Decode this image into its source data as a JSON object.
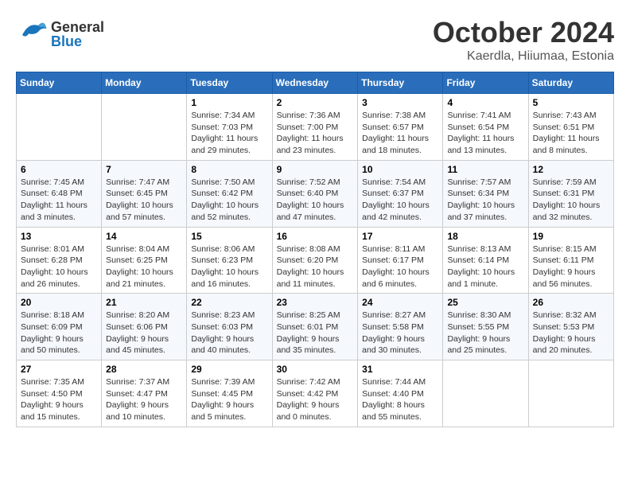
{
  "header": {
    "logo_general": "General",
    "logo_blue": "Blue",
    "month_title": "October 2024",
    "location": "Kaerdla, Hiiumaa, Estonia"
  },
  "days_of_week": [
    "Sunday",
    "Monday",
    "Tuesday",
    "Wednesday",
    "Thursday",
    "Friday",
    "Saturday"
  ],
  "weeks": [
    [
      {
        "day": "",
        "sunrise": "",
        "sunset": "",
        "daylight": ""
      },
      {
        "day": "",
        "sunrise": "",
        "sunset": "",
        "daylight": ""
      },
      {
        "day": "1",
        "sunrise": "Sunrise: 7:34 AM",
        "sunset": "Sunset: 7:03 PM",
        "daylight": "Daylight: 11 hours and 29 minutes."
      },
      {
        "day": "2",
        "sunrise": "Sunrise: 7:36 AM",
        "sunset": "Sunset: 7:00 PM",
        "daylight": "Daylight: 11 hours and 23 minutes."
      },
      {
        "day": "3",
        "sunrise": "Sunrise: 7:38 AM",
        "sunset": "Sunset: 6:57 PM",
        "daylight": "Daylight: 11 hours and 18 minutes."
      },
      {
        "day": "4",
        "sunrise": "Sunrise: 7:41 AM",
        "sunset": "Sunset: 6:54 PM",
        "daylight": "Daylight: 11 hours and 13 minutes."
      },
      {
        "day": "5",
        "sunrise": "Sunrise: 7:43 AM",
        "sunset": "Sunset: 6:51 PM",
        "daylight": "Daylight: 11 hours and 8 minutes."
      }
    ],
    [
      {
        "day": "6",
        "sunrise": "Sunrise: 7:45 AM",
        "sunset": "Sunset: 6:48 PM",
        "daylight": "Daylight: 11 hours and 3 minutes."
      },
      {
        "day": "7",
        "sunrise": "Sunrise: 7:47 AM",
        "sunset": "Sunset: 6:45 PM",
        "daylight": "Daylight: 10 hours and 57 minutes."
      },
      {
        "day": "8",
        "sunrise": "Sunrise: 7:50 AM",
        "sunset": "Sunset: 6:42 PM",
        "daylight": "Daylight: 10 hours and 52 minutes."
      },
      {
        "day": "9",
        "sunrise": "Sunrise: 7:52 AM",
        "sunset": "Sunset: 6:40 PM",
        "daylight": "Daylight: 10 hours and 47 minutes."
      },
      {
        "day": "10",
        "sunrise": "Sunrise: 7:54 AM",
        "sunset": "Sunset: 6:37 PM",
        "daylight": "Daylight: 10 hours and 42 minutes."
      },
      {
        "day": "11",
        "sunrise": "Sunrise: 7:57 AM",
        "sunset": "Sunset: 6:34 PM",
        "daylight": "Daylight: 10 hours and 37 minutes."
      },
      {
        "day": "12",
        "sunrise": "Sunrise: 7:59 AM",
        "sunset": "Sunset: 6:31 PM",
        "daylight": "Daylight: 10 hours and 32 minutes."
      }
    ],
    [
      {
        "day": "13",
        "sunrise": "Sunrise: 8:01 AM",
        "sunset": "Sunset: 6:28 PM",
        "daylight": "Daylight: 10 hours and 26 minutes."
      },
      {
        "day": "14",
        "sunrise": "Sunrise: 8:04 AM",
        "sunset": "Sunset: 6:25 PM",
        "daylight": "Daylight: 10 hours and 21 minutes."
      },
      {
        "day": "15",
        "sunrise": "Sunrise: 8:06 AM",
        "sunset": "Sunset: 6:23 PM",
        "daylight": "Daylight: 10 hours and 16 minutes."
      },
      {
        "day": "16",
        "sunrise": "Sunrise: 8:08 AM",
        "sunset": "Sunset: 6:20 PM",
        "daylight": "Daylight: 10 hours and 11 minutes."
      },
      {
        "day": "17",
        "sunrise": "Sunrise: 8:11 AM",
        "sunset": "Sunset: 6:17 PM",
        "daylight": "Daylight: 10 hours and 6 minutes."
      },
      {
        "day": "18",
        "sunrise": "Sunrise: 8:13 AM",
        "sunset": "Sunset: 6:14 PM",
        "daylight": "Daylight: 10 hours and 1 minute."
      },
      {
        "day": "19",
        "sunrise": "Sunrise: 8:15 AM",
        "sunset": "Sunset: 6:11 PM",
        "daylight": "Daylight: 9 hours and 56 minutes."
      }
    ],
    [
      {
        "day": "20",
        "sunrise": "Sunrise: 8:18 AM",
        "sunset": "Sunset: 6:09 PM",
        "daylight": "Daylight: 9 hours and 50 minutes."
      },
      {
        "day": "21",
        "sunrise": "Sunrise: 8:20 AM",
        "sunset": "Sunset: 6:06 PM",
        "daylight": "Daylight: 9 hours and 45 minutes."
      },
      {
        "day": "22",
        "sunrise": "Sunrise: 8:23 AM",
        "sunset": "Sunset: 6:03 PM",
        "daylight": "Daylight: 9 hours and 40 minutes."
      },
      {
        "day": "23",
        "sunrise": "Sunrise: 8:25 AM",
        "sunset": "Sunset: 6:01 PM",
        "daylight": "Daylight: 9 hours and 35 minutes."
      },
      {
        "day": "24",
        "sunrise": "Sunrise: 8:27 AM",
        "sunset": "Sunset: 5:58 PM",
        "daylight": "Daylight: 9 hours and 30 minutes."
      },
      {
        "day": "25",
        "sunrise": "Sunrise: 8:30 AM",
        "sunset": "Sunset: 5:55 PM",
        "daylight": "Daylight: 9 hours and 25 minutes."
      },
      {
        "day": "26",
        "sunrise": "Sunrise: 8:32 AM",
        "sunset": "Sunset: 5:53 PM",
        "daylight": "Daylight: 9 hours and 20 minutes."
      }
    ],
    [
      {
        "day": "27",
        "sunrise": "Sunrise: 7:35 AM",
        "sunset": "Sunset: 4:50 PM",
        "daylight": "Daylight: 9 hours and 15 minutes."
      },
      {
        "day": "28",
        "sunrise": "Sunrise: 7:37 AM",
        "sunset": "Sunset: 4:47 PM",
        "daylight": "Daylight: 9 hours and 10 minutes."
      },
      {
        "day": "29",
        "sunrise": "Sunrise: 7:39 AM",
        "sunset": "Sunset: 4:45 PM",
        "daylight": "Daylight: 9 hours and 5 minutes."
      },
      {
        "day": "30",
        "sunrise": "Sunrise: 7:42 AM",
        "sunset": "Sunset: 4:42 PM",
        "daylight": "Daylight: 9 hours and 0 minutes."
      },
      {
        "day": "31",
        "sunrise": "Sunrise: 7:44 AM",
        "sunset": "Sunset: 4:40 PM",
        "daylight": "Daylight: 8 hours and 55 minutes."
      },
      {
        "day": "",
        "sunrise": "",
        "sunset": "",
        "daylight": ""
      },
      {
        "day": "",
        "sunrise": "",
        "sunset": "",
        "daylight": ""
      }
    ]
  ]
}
